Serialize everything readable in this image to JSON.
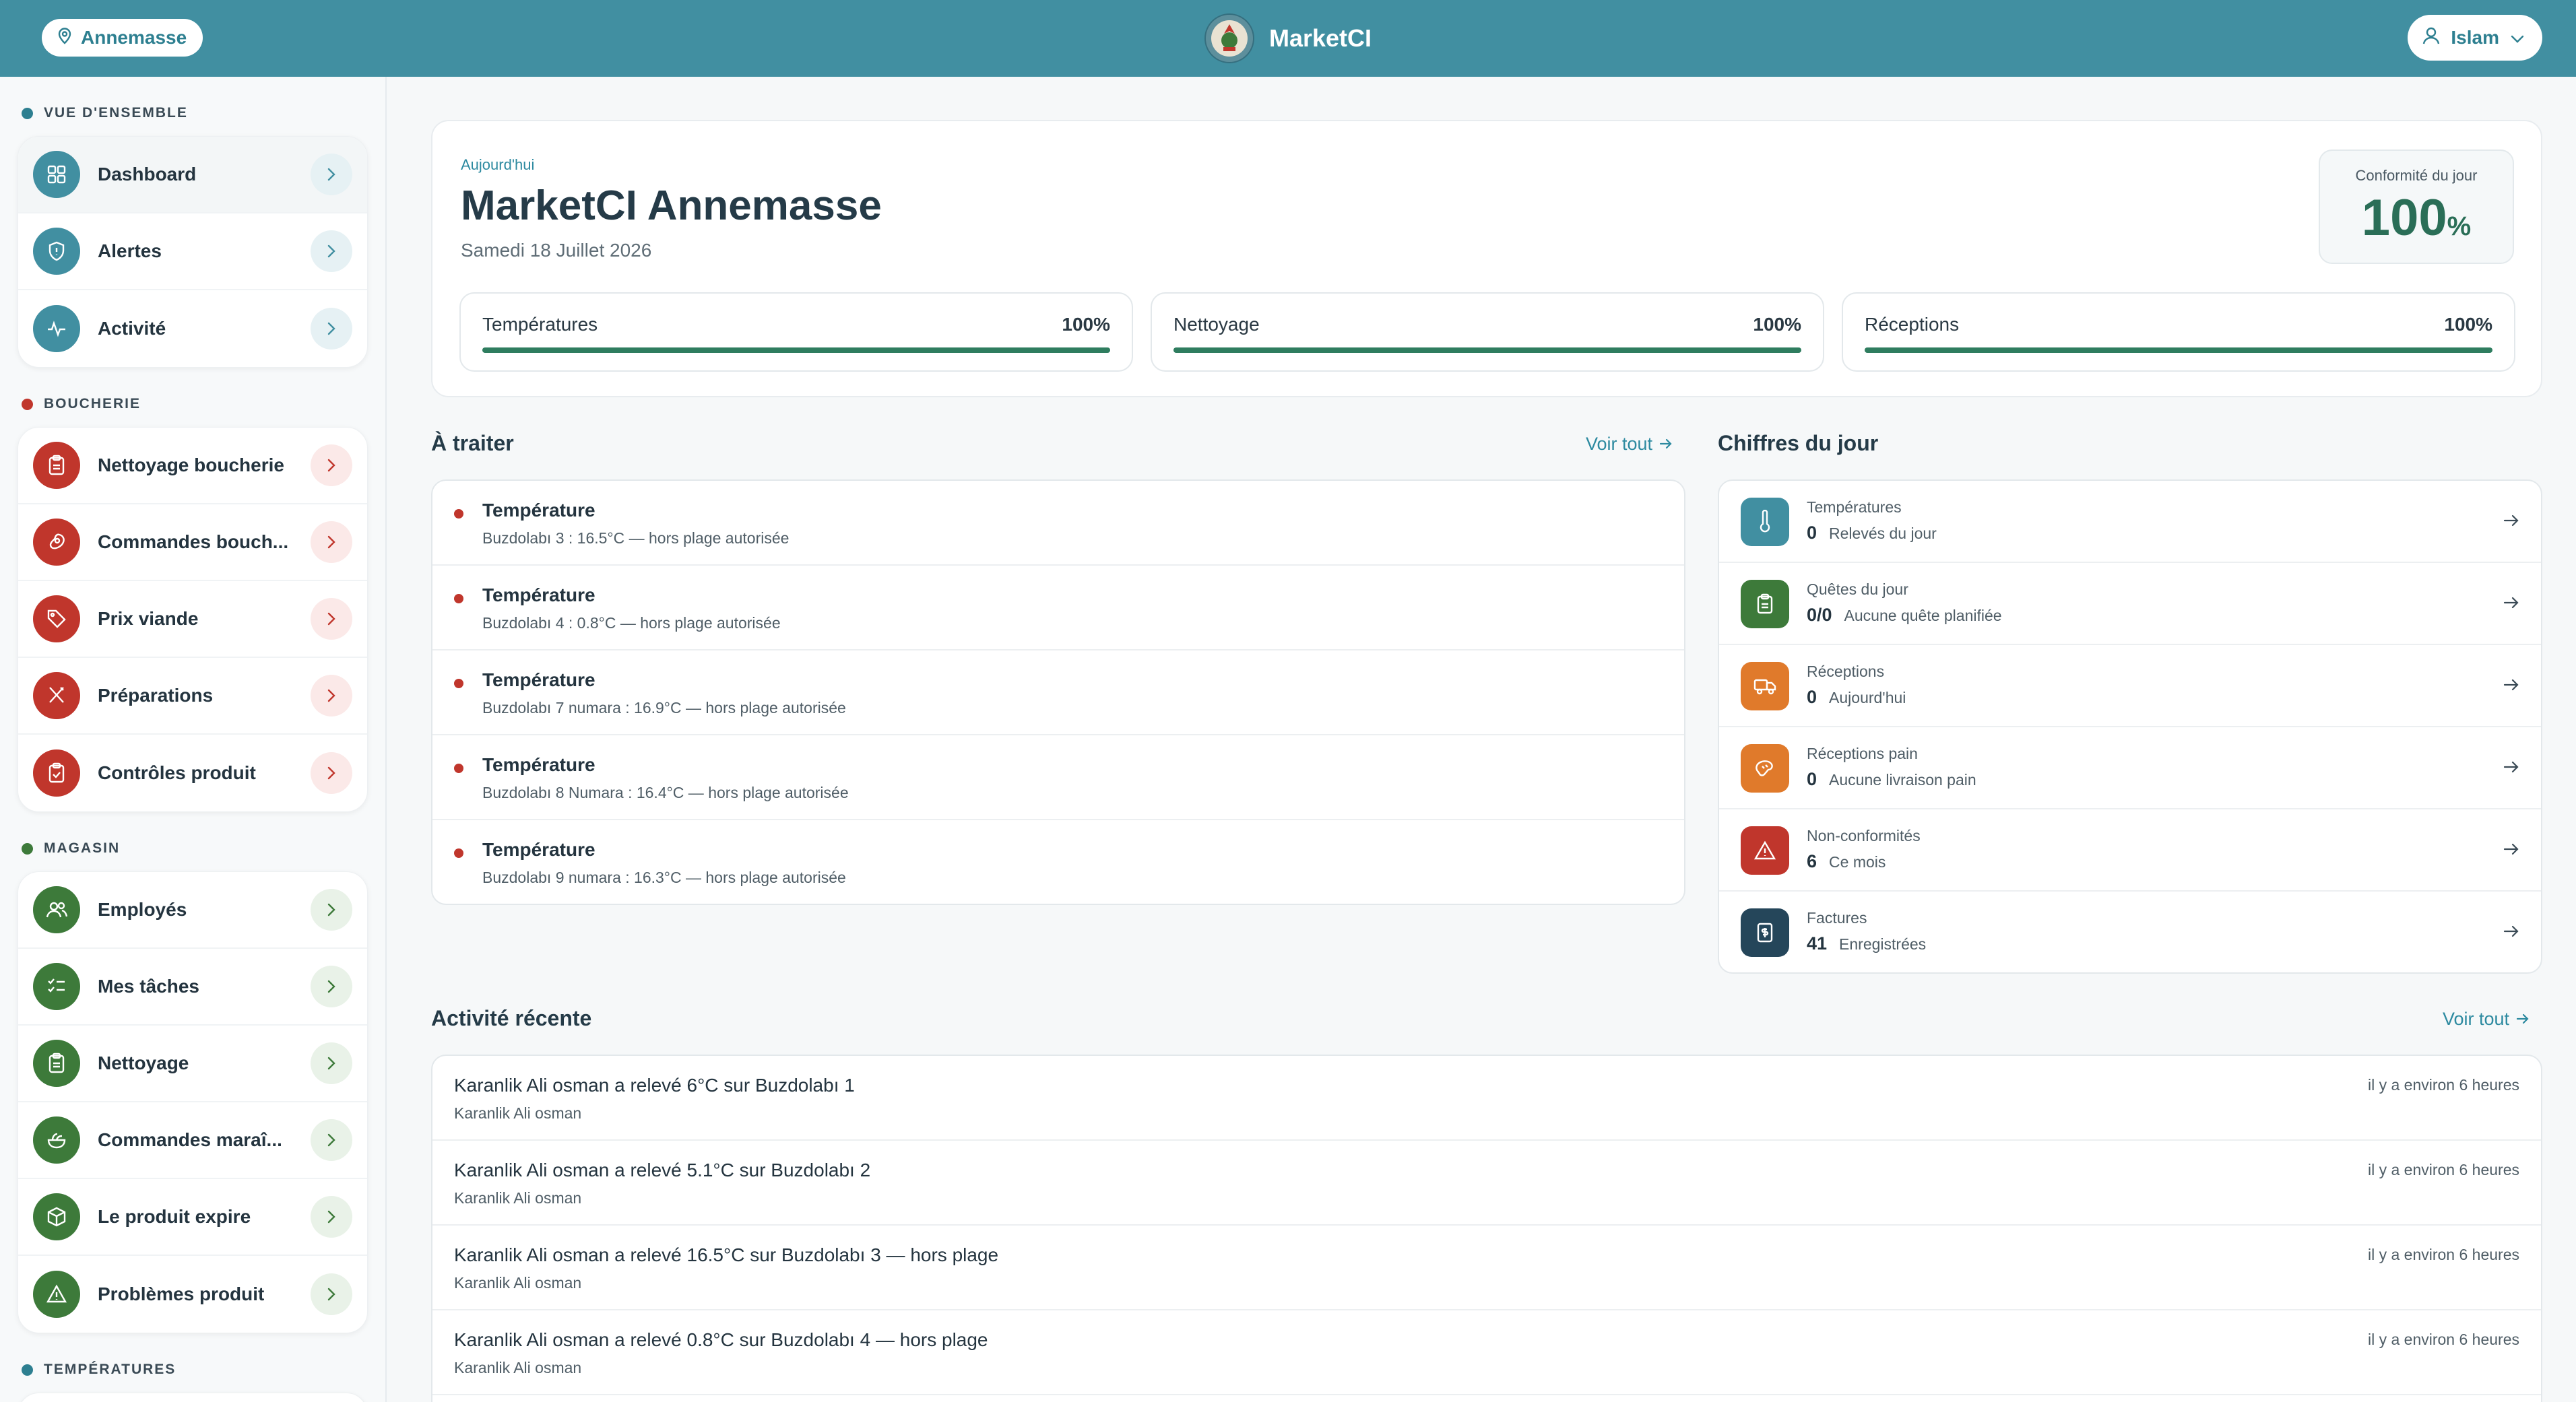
{
  "header": {
    "store_label": "Annemasse",
    "brand_name": "MarketCI",
    "user_name": "Islam",
    "bar_color": "#418fa1"
  },
  "sidebar": {
    "sections": [
      {
        "label": "VUE D'ENSEMBLE",
        "color": "#2d7f90",
        "items": [
          {
            "label": "Dashboard",
            "icon": "grid-icon",
            "active": true
          },
          {
            "label": "Alertes",
            "icon": "shield-icon"
          },
          {
            "label": "Activité",
            "icon": "pulse-icon"
          }
        ]
      },
      {
        "label": "BOUCHERIE",
        "color": "#c0362c",
        "items": [
          {
            "label": "Nettoyage boucherie",
            "icon": "clipboard-icon"
          },
          {
            "label": "Commandes bouch...",
            "icon": "meat-icon"
          },
          {
            "label": "Prix viande",
            "icon": "tag-icon"
          },
          {
            "label": "Préparations",
            "icon": "utensils-icon"
          },
          {
            "label": "Contrôles produit",
            "icon": "clipboard-check-icon"
          }
        ]
      },
      {
        "label": "MAGASIN",
        "color": "#3d7a3a",
        "items": [
          {
            "label": "Employés",
            "icon": "users-icon"
          },
          {
            "label": "Mes tâches",
            "icon": "checklist-icon"
          },
          {
            "label": "Nettoyage",
            "icon": "clipboard-icon"
          },
          {
            "label": "Commandes maraî...",
            "icon": "salad-icon"
          },
          {
            "label": "Le produit expire",
            "icon": "package-icon"
          },
          {
            "label": "Problèmes produit",
            "icon": "warning-icon"
          }
        ]
      },
      {
        "label": "TEMPÉRATURES",
        "color": "#2d7f90",
        "items": []
      }
    ]
  },
  "overview": {
    "today_label": "Aujourd'hui",
    "title": "MarketCI Annemasse",
    "date": "Samedi 18 Juillet 2026",
    "conformity_label": "Conformité du jour",
    "conformity_value": "100",
    "conformity_unit": "%",
    "metrics": [
      {
        "name": "Températures",
        "value": "100%",
        "progress": 1.0
      },
      {
        "name": "Nettoyage",
        "value": "100%",
        "progress": 1.0
      },
      {
        "name": "Réceptions",
        "value": "100%",
        "progress": 1.0
      }
    ]
  },
  "todo": {
    "title": "À traiter",
    "see_all": "Voir tout",
    "items": [
      {
        "title": "Température",
        "detail": "Buzdolabı 3 : 16.5°C — hors plage autorisée"
      },
      {
        "title": "Température",
        "detail": "Buzdolabı 4 : 0.8°C — hors plage autorisée"
      },
      {
        "title": "Température",
        "detail": "Buzdolabı 7 numara : 16.9°C — hors plage autorisée"
      },
      {
        "title": "Température",
        "detail": "Buzdolabı 8 Numara : 16.4°C — hors plage autorisée"
      },
      {
        "title": "Température",
        "detail": "Buzdolabı 9 numara : 16.3°C — hors plage autorisée"
      }
    ]
  },
  "stats": {
    "title": "Chiffres du jour",
    "items": [
      {
        "label": "Températures",
        "value": "0",
        "note": "Relevés du jour",
        "icon": "thermometer-icon",
        "color": "#418fa1"
      },
      {
        "label": "Quêtes du jour",
        "value": "0/0",
        "note": "Aucune quête planifiée",
        "icon": "clipboard-icon",
        "color": "#3d7a3a"
      },
      {
        "label": "Réceptions",
        "value": "0",
        "note": "Aujourd'hui",
        "icon": "truck-icon",
        "color": "#e07a2b"
      },
      {
        "label": "Réceptions pain",
        "value": "0",
        "note": "Aucune livraison pain",
        "icon": "bread-icon",
        "color": "#e07a2b"
      },
      {
        "label": "Non-conformités",
        "value": "6",
        "note": "Ce mois",
        "icon": "warning-icon",
        "color": "#c0362c"
      },
      {
        "label": "Factures",
        "value": "41",
        "note": "Enregistrées",
        "icon": "invoice-icon",
        "color": "#25465a"
      }
    ]
  },
  "activity": {
    "title": "Activité récente",
    "see_all": "Voir tout",
    "items": [
      {
        "title": "Karanlik Ali osman a relevé 6°C sur Buzdolabı 1",
        "user": "Karanlik Ali osman",
        "time": "il y a environ 6 heures"
      },
      {
        "title": "Karanlik Ali osman a relevé 5.1°C sur Buzdolabı 2",
        "user": "Karanlik Ali osman",
        "time": "il y a environ 6 heures"
      },
      {
        "title": "Karanlik Ali osman a relevé 16.5°C sur Buzdolabı 3 — hors plage",
        "user": "Karanlik Ali osman",
        "time": "il y a environ 6 heures"
      },
      {
        "title": "Karanlik Ali osman a relevé 0.8°C sur Buzdolabı 4 — hors plage",
        "user": "Karanlik Ali osman",
        "time": "il y a environ 6 heures"
      }
    ]
  }
}
